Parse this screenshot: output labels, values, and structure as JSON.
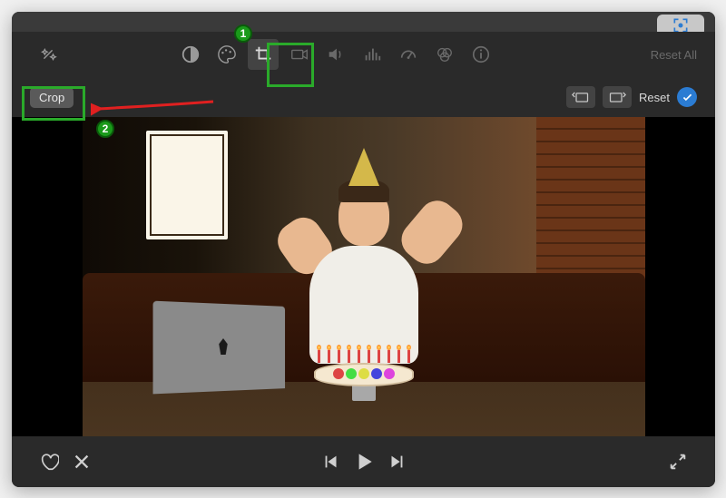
{
  "toolbar": {
    "reset_all_label": "Reset All",
    "icons": {
      "magic_wand": "magic-wand-icon",
      "color_balance": "color-balance-icon",
      "color_wheel": "color-palette-icon",
      "crop": "crop-icon",
      "camera": "camera-icon",
      "volume": "volume-icon",
      "equalizer": "equalizer-icon",
      "speed": "speedometer-icon",
      "color_filter": "color-filter-icon",
      "info": "info-icon"
    }
  },
  "secondary": {
    "crop_label": "Crop",
    "reset_label": "Reset"
  },
  "playback": {
    "favorite": "heart-icon",
    "reject": "x-icon",
    "prev": "skip-back-icon",
    "play": "play-icon",
    "next": "skip-forward-icon",
    "fullscreen": "fullscreen-icon"
  },
  "annotations": {
    "badge1": "1",
    "badge2": "2"
  },
  "colors": {
    "highlight": "#2aaa2a",
    "arrow": "#e02020",
    "confirm": "#2b7cd3"
  }
}
